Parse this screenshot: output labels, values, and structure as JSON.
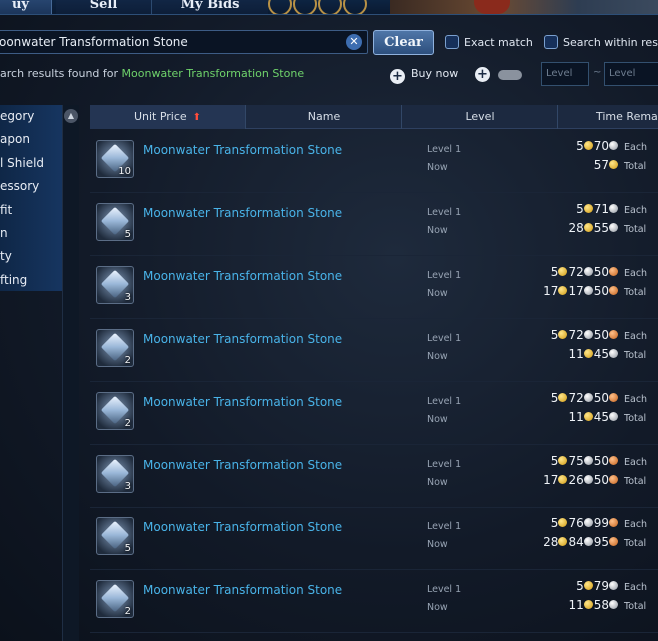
{
  "tabs": [
    {
      "label": "uy"
    },
    {
      "label": "Sell"
    },
    {
      "label": "My Bids"
    }
  ],
  "search": {
    "value": "oonwater Transformation Stone",
    "clear_label": "Clear",
    "exact_match_label": "Exact match",
    "search_within_label": "Search within resu"
  },
  "results": {
    "prefix": "arch results found for ",
    "term": "Moonwater Transformation Stone"
  },
  "filters": {
    "buy_now_label": "Buy now",
    "level_min_placeholder": "Level",
    "level_sep": "~",
    "level_max_placeholder": "Level"
  },
  "sidebar": {
    "items": [
      {
        "label": "egory"
      },
      {
        "label": "apon"
      },
      {
        "label": "l Shield"
      },
      {
        "label": "essory"
      },
      {
        "label": "fit"
      },
      {
        "label": "n"
      },
      {
        "label": "ty"
      },
      {
        "label": "fting"
      }
    ]
  },
  "table": {
    "headers": {
      "price": "Unit Price",
      "name": "Name",
      "level": "Level",
      "time": "Time Rema"
    },
    "each_label": "Each",
    "total_label": "Total",
    "rows": [
      {
        "name": "Moonwater Transformation Stone",
        "qty": "10",
        "level": "Level 1",
        "buy": "Now",
        "each": [
          [
            "5",
            "gold"
          ],
          [
            "70",
            "silver"
          ]
        ],
        "total": [
          [
            "57",
            "gold"
          ]
        ]
      },
      {
        "name": "Moonwater Transformation Stone",
        "qty": "5",
        "level": "Level 1",
        "buy": "Now",
        "each": [
          [
            "5",
            "gold"
          ],
          [
            "71",
            "silver"
          ]
        ],
        "total": [
          [
            "28",
            "gold"
          ],
          [
            "55",
            "silver"
          ]
        ]
      },
      {
        "name": "Moonwater Transformation Stone",
        "qty": "3",
        "level": "Level 1",
        "buy": "Now",
        "each": [
          [
            "5",
            "gold"
          ],
          [
            "72",
            "silver"
          ],
          [
            "50",
            "copper"
          ]
        ],
        "total": [
          [
            "17",
            "gold"
          ],
          [
            "17",
            "silver"
          ],
          [
            "50",
            "copper"
          ]
        ]
      },
      {
        "name": "Moonwater Transformation Stone",
        "qty": "2",
        "level": "Level 1",
        "buy": "Now",
        "each": [
          [
            "5",
            "gold"
          ],
          [
            "72",
            "silver"
          ],
          [
            "50",
            "copper"
          ]
        ],
        "total": [
          [
            "11",
            "gold"
          ],
          [
            "45",
            "silver"
          ]
        ]
      },
      {
        "name": "Moonwater Transformation Stone",
        "qty": "2",
        "level": "Level 1",
        "buy": "Now",
        "each": [
          [
            "5",
            "gold"
          ],
          [
            "72",
            "silver"
          ],
          [
            "50",
            "copper"
          ]
        ],
        "total": [
          [
            "11",
            "gold"
          ],
          [
            "45",
            "silver"
          ]
        ]
      },
      {
        "name": "Moonwater Transformation Stone",
        "qty": "3",
        "level": "Level 1",
        "buy": "Now",
        "each": [
          [
            "5",
            "gold"
          ],
          [
            "75",
            "silver"
          ],
          [
            "50",
            "copper"
          ]
        ],
        "total": [
          [
            "17",
            "gold"
          ],
          [
            "26",
            "silver"
          ],
          [
            "50",
            "copper"
          ]
        ]
      },
      {
        "name": "Moonwater Transformation Stone",
        "qty": "5",
        "level": "Level 1",
        "buy": "Now",
        "each": [
          [
            "5",
            "gold"
          ],
          [
            "76",
            "silver"
          ],
          [
            "99",
            "copper"
          ]
        ],
        "total": [
          [
            "28",
            "gold"
          ],
          [
            "84",
            "silver"
          ],
          [
            "95",
            "copper"
          ]
        ]
      },
      {
        "name": "Moonwater Transformation Stone",
        "qty": "2",
        "level": "Level 1",
        "buy": "Now",
        "each": [
          [
            "5",
            "gold"
          ],
          [
            "79",
            "silver"
          ]
        ],
        "total": [
          [
            "11",
            "gold"
          ],
          [
            "58",
            "silver"
          ]
        ]
      }
    ]
  },
  "colors": {
    "link_name": "#49b3e8",
    "search_term": "#6fd36b",
    "sort_arrow": "#ff4c3b"
  }
}
